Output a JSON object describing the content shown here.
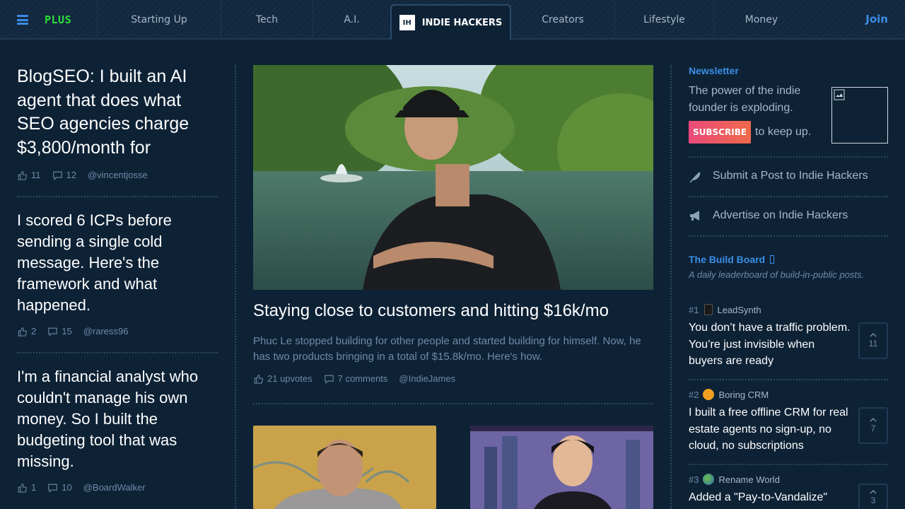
{
  "nav": {
    "plus_label": "PLUS",
    "tabs": [
      "Starting Up",
      "Tech",
      "A.I.",
      "Creators",
      "Lifestyle",
      "Money"
    ],
    "active_tab": {
      "logo": "IH",
      "label": "INDIE HACKERS"
    },
    "join_label": "Join",
    "accent": "#3a8ee6"
  },
  "left_posts": [
    {
      "title": "BlogSEO: I built an AI agent that does what SEO agencies charge $3,800/month for",
      "upvotes": "11",
      "comments": "12",
      "author": "@vincentjosse"
    },
    {
      "title": "I scored 6 ICPs before sending a single cold message. Here's the framework and what happened.",
      "upvotes": "2",
      "comments": "15",
      "author": "@raress96"
    },
    {
      "title": "I'm a financial analyst who couldn't manage his own money. So I built the budgeting tool that was missing.",
      "upvotes": "1",
      "comments": "10",
      "author": "@BoardWalker"
    }
  ],
  "featured": {
    "title": "Staying close to customers and hitting $16k/mo",
    "description": "Phuc Le stopped building for other people and started building for himself. Now, he has two products bringing in a total of $15.8k/mo. Here's how.",
    "upvotes": "21 upvotes",
    "comments": "7 comments",
    "author": "@IndieJames"
  },
  "newsletter": {
    "heading": "Newsletter",
    "text": "The power of the indie founder is exploding.",
    "subscribe_label": "SUBSCRIBE",
    "tail": "to keep up."
  },
  "side_links": {
    "submit": "Submit a Post to Indie Hackers",
    "advertise": "Advertise on Indie Hackers"
  },
  "build_board": {
    "heading": "The Build Board",
    "subtitle": "A daily leaderboard of build-in-public posts.",
    "items": [
      {
        "rank": "#1",
        "product": "LeadSynth",
        "title": "You don’t have a traffic problem. You’re just invisible when buyers are ready",
        "votes": "11"
      },
      {
        "rank": "#2",
        "product": "Boring CRM",
        "title": "I built a free offline CRM for real estate agents no sign-up, no cloud, no subscriptions",
        "votes": "7"
      },
      {
        "rank": "#3",
        "product": "Rename World",
        "title": "Added a \"Pay-to-Vandalize\"",
        "votes": "3"
      }
    ]
  },
  "colors": {
    "background": "#0e2236",
    "muted_text": "#6d8aa6",
    "plus_green": "#2dde3a"
  }
}
